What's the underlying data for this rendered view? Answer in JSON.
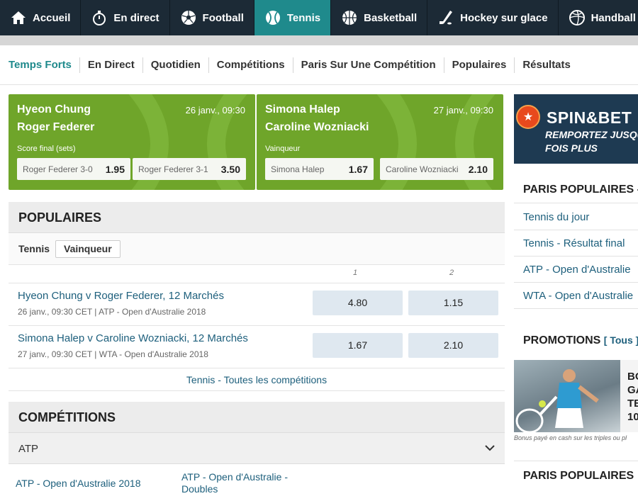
{
  "nav": {
    "sports": [
      {
        "label": "Accueil",
        "icon": "home-icon"
      },
      {
        "label": "En direct",
        "icon": "stopwatch-icon"
      },
      {
        "label": "Football",
        "icon": "football-icon"
      },
      {
        "label": "Tennis",
        "icon": "tennis-ball-icon",
        "active": true
      },
      {
        "label": "Basketball",
        "icon": "basketball-icon"
      },
      {
        "label": "Hockey sur glace",
        "icon": "hockey-stick-icon"
      },
      {
        "label": "Handball",
        "icon": "handball-icon"
      }
    ]
  },
  "subtabs": [
    "Temps Forts",
    "En Direct",
    "Quotidien",
    "Compétitions",
    "Paris Sur Une Compétition",
    "Populaires",
    "Résultats"
  ],
  "featured": [
    {
      "player1": "Hyeon Chung",
      "player2": "Roger Federer",
      "date": "26 janv., 09:30",
      "market": "Score final (sets)",
      "odds": [
        {
          "name": "Roger Federer 3-0",
          "value": "1.95"
        },
        {
          "name": "Roger Federer 3-1",
          "value": "3.50"
        }
      ]
    },
    {
      "player1": "Simona Halep",
      "player2": "Caroline Wozniacki",
      "date": "27 janv., 09:30",
      "market": "Vainqueur",
      "odds": [
        {
          "name": "Simona Halep",
          "value": "1.67"
        },
        {
          "name": "Caroline Wozniacki",
          "value": "2.10"
        }
      ]
    }
  ],
  "populaires": {
    "title": "POPULAIRES",
    "sport": "Tennis",
    "market_chip": "Vainqueur",
    "col1": "1",
    "col2": "2",
    "matches": [
      {
        "title": "Hyeon Chung v Roger Federer",
        "markets": ", 12 Marchés",
        "sub": "26 janv., 09:30 CET | ATP - Open d'Australie 2018",
        "odd1": "4.80",
        "odd2": "1.15"
      },
      {
        "title": "Simona Halep v Caroline Wozniacki",
        "markets": ", 12 Marchés",
        "sub": "27 janv., 09:30 CET | WTA - Open d'Australie 2018",
        "odd1": "1.67",
        "odd2": "2.10"
      }
    ],
    "all_link": "Tennis - Toutes les compétitions"
  },
  "competitions": {
    "title": "COMPÉTITIONS",
    "group": "ATP",
    "links": [
      "ATP - Open d'Australie 2018",
      "ATP - Open d'Australie -",
      "Doubles"
    ]
  },
  "sidebar": {
    "spin_title": "SPIN&BET",
    "spin_line1": "REMPORTEZ JUSQU",
    "spin_line2": "FOIS PLUS",
    "paris_title": "PARIS POPULAIRES - T",
    "paris_links": [
      "Tennis du jour",
      "Tennis - Résultat final",
      "ATP - Open d'Australie",
      "WTA - Open d'Australie"
    ],
    "promos_title": "PROMOTIONS",
    "promos_link": "[ Tous ]",
    "promo_text": [
      "BO",
      "GA",
      "TE",
      "10"
    ],
    "promo_note": "Bonus payé en cash sur les triples ou pl",
    "paris_title_2": "PARIS POPULAIRES"
  }
}
